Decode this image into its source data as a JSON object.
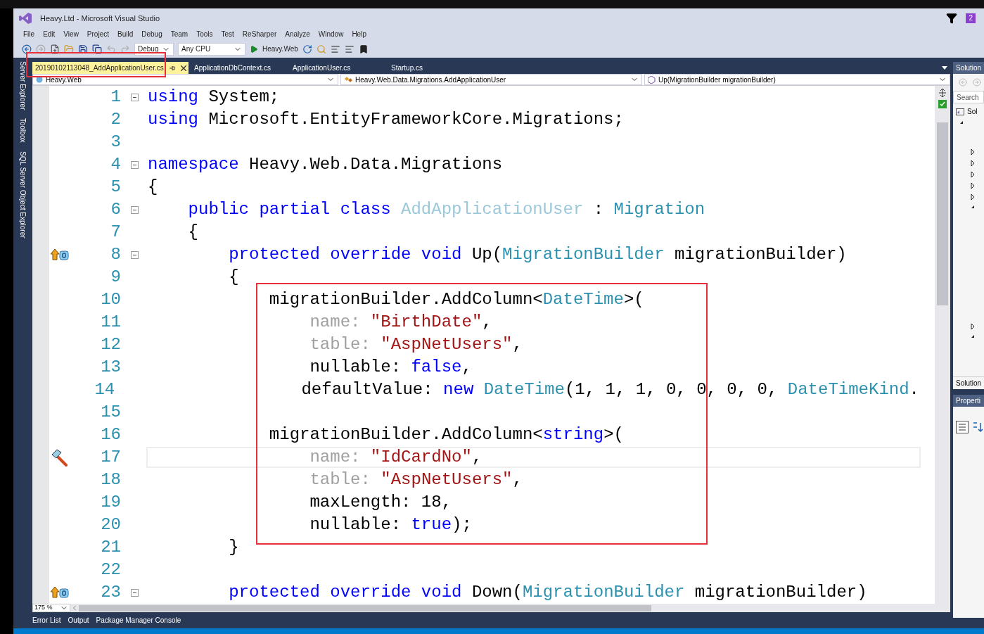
{
  "window": {
    "title": "Heavy.Ltd - Microsoft Visual Studio",
    "notification_count": "2"
  },
  "menu": [
    "File",
    "Edit",
    "View",
    "Project",
    "Build",
    "Debug",
    "Team",
    "Tools",
    "Test",
    "ReSharper",
    "Analyze",
    "Window",
    "Help"
  ],
  "toolbar": {
    "configuration": "Debug",
    "platform": "Any CPU",
    "start_project": "Heavy.Web"
  },
  "tool_tabs": [
    "Server Explorer",
    "Toolbox",
    "SQL Server Object Explorer"
  ],
  "document_tabs": [
    {
      "label": "20190102113048_AddApplicationUser.cs",
      "selected": true
    },
    {
      "label": "ApplicationDbContext.cs",
      "selected": false
    },
    {
      "label": "ApplicationUser.cs",
      "selected": false
    },
    {
      "label": "Startup.cs",
      "selected": false
    }
  ],
  "navigation": {
    "project": "Heavy.Web",
    "type": "Heavy.Web.Data.Migrations.AddApplicationUser",
    "member": "Up(MigrationBuilder migrationBuilder)"
  },
  "editor": {
    "zoom": "175 %",
    "lines": [
      {
        "number": "1",
        "kind": "plain",
        "fold": true,
        "current": false,
        "tokens": [
          {
            "kind": "kw",
            "text": "using"
          },
          {
            "kind": "plain",
            "text": " System;"
          }
        ]
      },
      {
        "number": "2",
        "kind": "plain",
        "fold": false,
        "current": false,
        "tokens": [
          {
            "kind": "kw",
            "text": "using"
          },
          {
            "kind": "plain",
            "text": " Microsoft.EntityFrameworkCore.Migrations;"
          }
        ]
      },
      {
        "number": "3",
        "kind": "plain",
        "fold": false,
        "current": false
      },
      {
        "number": "4",
        "kind": "plain",
        "fold": true,
        "current": false,
        "tokens": [
          {
            "kind": "kw",
            "text": "namespace"
          },
          {
            "kind": "plain",
            "text": " Heavy.Web.Data.Migrations"
          }
        ]
      },
      {
        "number": "5",
        "kind": "plain",
        "fold": false,
        "current": false,
        "tokens": [
          {
            "kind": "plain",
            "text": "{"
          }
        ]
      },
      {
        "number": "6",
        "kind": "plain",
        "fold": true,
        "current": false,
        "tokens": [
          {
            "kind": "kw",
            "text": "    public partial class "
          },
          {
            "kind": "cls",
            "text": "AddApplicationUser"
          },
          {
            "kind": "plain",
            "text": " : "
          },
          {
            "kind": "type",
            "text": "Migration"
          }
        ]
      },
      {
        "number": "7",
        "kind": "plain",
        "fold": false,
        "current": false,
        "tokens": [
          {
            "kind": "plain",
            "text": "    {"
          }
        ]
      },
      {
        "number": "8",
        "kind": "override",
        "fold": true,
        "current": false,
        "tokens": [
          {
            "kind": "kw",
            "text": "        protected override void"
          },
          {
            "kind": "plain",
            "text": " Up("
          },
          {
            "kind": "type",
            "text": "MigrationBuilder"
          },
          {
            "kind": "plain",
            "text": " migrationBuilder)"
          }
        ]
      },
      {
        "number": "9",
        "kind": "plain",
        "fold": false,
        "current": false,
        "tokens": [
          {
            "kind": "plain",
            "text": "        {"
          }
        ]
      },
      {
        "number": "10",
        "kind": "plain",
        "fold": false,
        "current": false,
        "tokens": [
          {
            "kind": "plain",
            "text": "            migrationBuilder.AddColumn<"
          },
          {
            "kind": "type",
            "text": "DateTime"
          },
          {
            "kind": "plain",
            "text": ">("
          }
        ]
      },
      {
        "number": "11",
        "kind": "plain",
        "fold": false,
        "current": false,
        "tokens": [
          {
            "kind": "param",
            "text": "                name: "
          },
          {
            "kind": "str",
            "text": "\"BirthDate\""
          },
          {
            "kind": "plain",
            "text": ","
          }
        ]
      },
      {
        "number": "12",
        "kind": "plain",
        "fold": false,
        "current": false,
        "tokens": [
          {
            "kind": "param",
            "text": "                table: "
          },
          {
            "kind": "str",
            "text": "\"AspNetUsers\""
          },
          {
            "kind": "plain",
            "text": ","
          }
        ]
      },
      {
        "number": "13",
        "kind": "plain",
        "fold": false,
        "current": false,
        "tokens": [
          {
            "kind": "plain",
            "text": "                nullable: "
          },
          {
            "kind": "kw",
            "text": "false"
          },
          {
            "kind": "plain",
            "text": ","
          }
        ]
      },
      {
        "number": "14",
        "kind": "plain",
        "fold": false,
        "current": false,
        "tokens": [
          {
            "kind": "plain",
            "text": "                defaultValue: "
          },
          {
            "kind": "kw",
            "text": "new "
          },
          {
            "kind": "type",
            "text": "DateTime"
          },
          {
            "kind": "plain",
            "text": "(1, 1, 1, 0, 0, 0, 0, "
          },
          {
            "kind": "type",
            "text": "DateTimeKind"
          },
          {
            "kind": "plain",
            "text": "."
          }
        ]
      },
      {
        "number": "15",
        "kind": "plain",
        "fold": false,
        "current": false
      },
      {
        "number": "16",
        "kind": "plain",
        "fold": false,
        "current": false,
        "tokens": [
          {
            "kind": "plain",
            "text": "            migrationBuilder.AddColumn<"
          },
          {
            "kind": "kw",
            "text": "string"
          },
          {
            "kind": "plain",
            "text": ">("
          }
        ]
      },
      {
        "number": "17",
        "kind": "hammer",
        "fold": false,
        "current": true,
        "tokens": [
          {
            "kind": "param",
            "text": "                name: "
          },
          {
            "kind": "str",
            "text": "\"IdCardNo\""
          },
          {
            "kind": "plain",
            "text": ","
          }
        ]
      },
      {
        "number": "18",
        "kind": "plain",
        "fold": false,
        "current": false,
        "tokens": [
          {
            "kind": "param",
            "text": "                table: "
          },
          {
            "kind": "str",
            "text": "\"AspNetUsers\""
          },
          {
            "kind": "plain",
            "text": ","
          }
        ]
      },
      {
        "number": "19",
        "kind": "plain",
        "fold": false,
        "current": false,
        "tokens": [
          {
            "kind": "plain",
            "text": "                maxLength: 18,"
          }
        ]
      },
      {
        "number": "20",
        "kind": "plain",
        "fold": false,
        "current": false,
        "tokens": [
          {
            "kind": "plain",
            "text": "                nullable: "
          },
          {
            "kind": "kw",
            "text": "true"
          },
          {
            "kind": "plain",
            "text": ");"
          }
        ]
      },
      {
        "number": "21",
        "kind": "plain",
        "fold": false,
        "current": false,
        "tokens": [
          {
            "kind": "plain",
            "text": "        }"
          }
        ]
      },
      {
        "number": "22",
        "kind": "plain",
        "fold": false,
        "current": false
      },
      {
        "number": "23",
        "kind": "override",
        "fold": true,
        "current": false,
        "tokens": [
          {
            "kind": "kw",
            "text": "        protected override void"
          },
          {
            "kind": "plain",
            "text": " Down("
          },
          {
            "kind": "type",
            "text": "MigrationBuilder"
          },
          {
            "kind": "plain",
            "text": " migrationBuilder)"
          }
        ]
      }
    ]
  },
  "solution_explorer": {
    "title": "Solution",
    "search_placeholder": "Search",
    "root": "Sol",
    "footer_tab": "Solution"
  },
  "properties": {
    "title": "Properti"
  },
  "bottom_tabs": [
    "Error List",
    "Output",
    "Package Manager Console"
  ]
}
